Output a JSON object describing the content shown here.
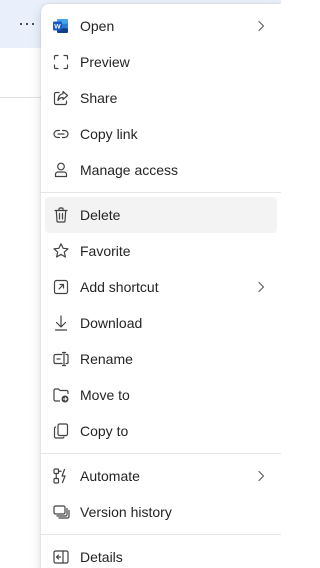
{
  "toolbar": {
    "more_label": "···"
  },
  "menu": {
    "items": [
      {
        "label": "Open",
        "icon": "word-icon",
        "submenu": true
      },
      {
        "label": "Preview",
        "icon": "preview-icon"
      },
      {
        "label": "Share",
        "icon": "share-icon"
      },
      {
        "label": "Copy link",
        "icon": "link-icon"
      },
      {
        "label": "Manage access",
        "icon": "person-icon"
      },
      {
        "label": "Delete",
        "icon": "trash-icon",
        "highlighted": true
      },
      {
        "label": "Favorite",
        "icon": "star-icon"
      },
      {
        "label": "Add shortcut",
        "icon": "shortcut-icon",
        "submenu": true
      },
      {
        "label": "Download",
        "icon": "download-icon"
      },
      {
        "label": "Rename",
        "icon": "rename-icon"
      },
      {
        "label": "Move to",
        "icon": "move-icon"
      },
      {
        "label": "Copy to",
        "icon": "copy-icon"
      },
      {
        "label": "Automate",
        "icon": "automate-icon",
        "submenu": true
      },
      {
        "label": "Version history",
        "icon": "version-history-icon"
      },
      {
        "label": "Details",
        "icon": "details-icon"
      }
    ]
  },
  "colors": {
    "word_blue": "#185abd",
    "text": "#242424",
    "icon": "#424242",
    "hover_bg": "#f3f3f3",
    "row_highlight": "#eaf0fb"
  }
}
